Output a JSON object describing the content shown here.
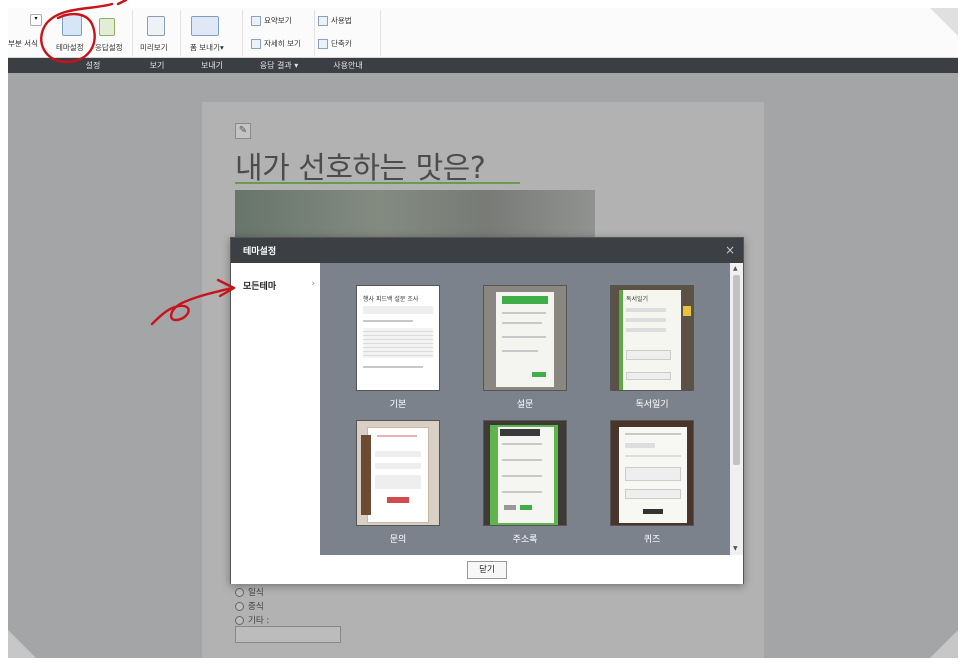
{
  "ribbon": {
    "partial_style": "부분 서식",
    "theme_settings": "테마설정",
    "response_settings": "응답설정",
    "preview": "미리보기",
    "send_form": "폼 보내기",
    "send_caret": "▾",
    "summary_view": "요약보기",
    "detail_view": "자세히 보기",
    "how_to_use": "사용법",
    "shortcuts": "단축키",
    "groups": {
      "settings": "설정",
      "view": "보기",
      "send": "보내기",
      "results": "응답 결과",
      "results_caret": "▾",
      "guide": "사용안내"
    }
  },
  "survey": {
    "title": "내가 선호하는 맛은?",
    "options": [
      "일식",
      "중식",
      "기타 :"
    ]
  },
  "modal": {
    "title": "테마설정",
    "close_x": "×",
    "sidebar": {
      "label": "모든테마",
      "chevron": "›"
    },
    "themes": [
      {
        "label": "기본",
        "preview_title": "행사 피드백 설문 조사"
      },
      {
        "label": "설문",
        "preview_title": ""
      },
      {
        "label": "독서일기",
        "preview_title": "독서일기"
      },
      {
        "label": "문의",
        "preview_title": ""
      },
      {
        "label": "주소록",
        "preview_title": ""
      },
      {
        "label": "퀴즈",
        "preview_title": ""
      }
    ],
    "close_button": "닫기"
  },
  "colors": {
    "ribbon_dark": "#3b3e43",
    "canvas": "#a4a5a7",
    "modal_grid": "#7c828c",
    "accent_green": "#6a9a50",
    "annotation_red": "#c8131b"
  }
}
